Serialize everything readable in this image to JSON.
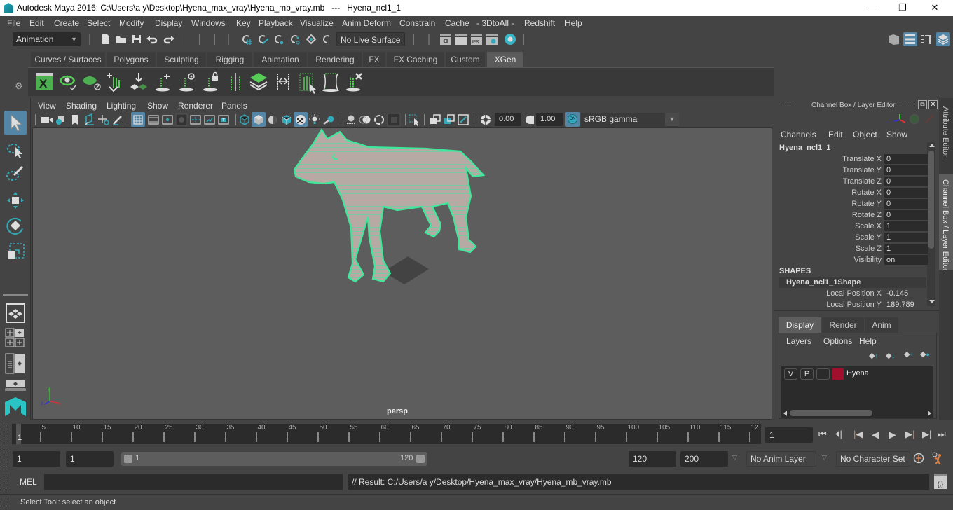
{
  "window": {
    "title": "Autodesk Maya 2016: C:\\Users\\a y\\Desktop\\Hyena_max_vray\\Hyena_mb_vray.mb   ---   Hyena_ncl1_1",
    "minimize": "—",
    "restore": "❐",
    "close": "✕"
  },
  "menubar": [
    "File",
    "Edit",
    "Create",
    "Select",
    "Modify",
    "Display",
    "Windows",
    "Key",
    "Playback",
    "Visualize",
    "Anim Deform",
    "Constrain",
    "Cache",
    "- 3DtoAll -",
    "Redshift",
    "Help"
  ],
  "statusline": {
    "menuset": "Animation",
    "live_surface": "No Live Surface"
  },
  "shelf": {
    "tabs": [
      "Curves / Surfaces",
      "Polygons",
      "Sculpting",
      "Rigging",
      "Animation",
      "Rendering",
      "FX",
      "FX Caching",
      "Custom",
      "XGen"
    ],
    "active_tab": "XGen"
  },
  "panel": {
    "menus": [
      "View",
      "Shading",
      "Lighting",
      "Show",
      "Renderer",
      "Panels"
    ],
    "exposure": "0.00",
    "gamma": "1.00",
    "color_mgmt_toggle": "ON",
    "color_space": "sRGB gamma",
    "camera_label": "persp",
    "axis_labels": {
      "x": "x",
      "y": "y",
      "z": "z"
    }
  },
  "channel_box": {
    "title": "Channel Box / Layer Editor",
    "menus": [
      "Channels",
      "Edit",
      "Object",
      "Show"
    ],
    "object_name": "Hyena_ncl1_1",
    "channels": [
      {
        "label": "Translate X",
        "value": "0"
      },
      {
        "label": "Translate Y",
        "value": "0"
      },
      {
        "label": "Translate Z",
        "value": "0"
      },
      {
        "label": "Rotate X",
        "value": "0"
      },
      {
        "label": "Rotate Y",
        "value": "0"
      },
      {
        "label": "Rotate Z",
        "value": "0"
      },
      {
        "label": "Scale X",
        "value": "1"
      },
      {
        "label": "Scale Y",
        "value": "1"
      },
      {
        "label": "Scale Z",
        "value": "1"
      },
      {
        "label": "Visibility",
        "value": "on"
      }
    ],
    "shapes_header": "SHAPES",
    "shape_name": "Hyena_ncl1_1Shape",
    "shape_channels": [
      {
        "label": "Local Position X",
        "value": "-0.145"
      },
      {
        "label": "Local Position Y",
        "value": "189.789"
      }
    ]
  },
  "side_tabs": {
    "attribute_editor": "Attribute Editor",
    "channel_box": "Channel Box / Layer Editor"
  },
  "layer_editor": {
    "tabs": [
      "Display",
      "Render",
      "Anim"
    ],
    "active_tab": "Display",
    "menus": [
      "Layers",
      "Options",
      "Help"
    ],
    "layers": [
      {
        "v": "V",
        "p": "P",
        "name": "Hyena",
        "color": "#a0102c"
      }
    ]
  },
  "timeline": {
    "ticks": [
      "5",
      "10",
      "15",
      "20",
      "25",
      "30",
      "35",
      "40",
      "45",
      "50",
      "55",
      "60",
      "65",
      "70",
      "75",
      "80",
      "85",
      "90",
      "95",
      "100",
      "105",
      "110",
      "115",
      "12"
    ],
    "current_frame_marker": "1",
    "current_frame": "1"
  },
  "range": {
    "start": "1",
    "playback_start": "1",
    "slider_min": "1",
    "slider_max": "120",
    "playback_end": "120",
    "end": "200",
    "anim_layer": "No Anim Layer",
    "character_set": "No Character Set"
  },
  "command": {
    "lang": "MEL",
    "input": "",
    "result": "// Result: C:/Users/a y/Desktop/Hyena_max_vray/Hyena_mb_vray.mb"
  },
  "help_line": "Select Tool: select an object",
  "colors": {
    "accent": "#5285a6",
    "wire": "#3ee89a",
    "layer_color": "#a0102c"
  }
}
